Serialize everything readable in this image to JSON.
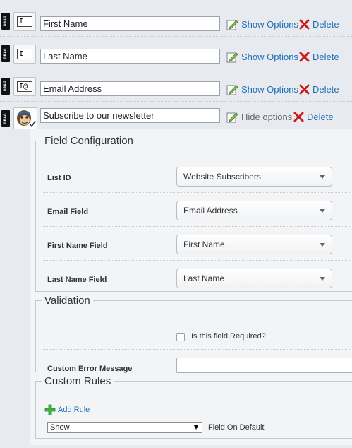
{
  "fields": [
    {
      "icon": "text-field-icon",
      "glyph": "I",
      "value": "First Name",
      "options_label": "Show Options",
      "delete_label": "Delete"
    },
    {
      "icon": "text-field-icon",
      "glyph": "I",
      "value": "Last Name",
      "options_label": "Show Options",
      "delete_label": "Delete"
    },
    {
      "icon": "email-field-icon",
      "glyph": "I@",
      "value": "Email Address",
      "options_label": "Show Options",
      "delete_label": "Delete"
    },
    {
      "icon": "mailchimp-icon",
      "glyph": "",
      "value": "Subscribe to our newsletter",
      "options_label": "Hide options",
      "delete_label": "Delete"
    }
  ],
  "drag_label": "DRAG",
  "field_configuration": {
    "legend": "Field Configuration",
    "list_id_label": "List ID",
    "list_id_value": "Website Subscribers",
    "email_field_label": "Email Field",
    "email_field_value": "Email Address",
    "first_name_field_label": "First Name Field",
    "first_name_field_value": "First Name",
    "last_name_field_label": "Last Name Field",
    "last_name_field_value": "Last Name"
  },
  "validation": {
    "legend": "Validation",
    "required_label": "Is this field Required?",
    "required_checked": false,
    "custom_error_label": "Custom Error Message",
    "custom_error_value": ""
  },
  "custom_rules": {
    "legend": "Custom Rules",
    "add_rule_label": "Add Rule",
    "show_select_value": "Show",
    "field_on_default_label": "Field On Default"
  },
  "colors": {
    "link": "#1e6fb8",
    "delete_x": "#cc1a1a",
    "add_plus": "#3cb043"
  }
}
